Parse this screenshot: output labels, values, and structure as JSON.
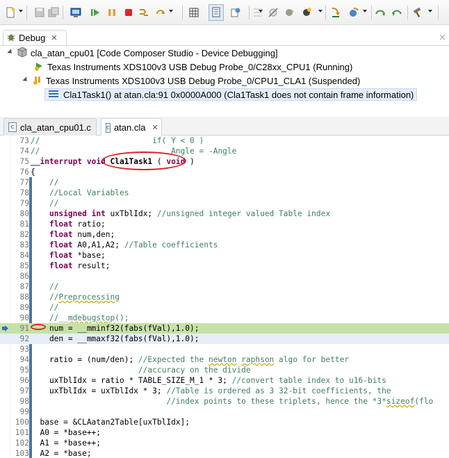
{
  "toolbar": {
    "icons": [
      "new-icon",
      "save-icon",
      "save-all-icon",
      "terminal-icon",
      "resume-icon",
      "suspend-icon",
      "terminate-icon",
      "reset-icon",
      "restart-icon",
      "memory-grid-icon",
      "debug-view-icon",
      "breakpoint-icon",
      "skip-breakpoints-icon",
      "hardware-breakpoint-icon",
      "step-into-icon",
      "step-over-icon",
      "step-return-icon",
      "step-back-icon",
      "build-icon"
    ]
  },
  "debug": {
    "tab_label": "Debug",
    "session": "cla_atan_cpu01 [Code Composer Studio - Device Debugging]",
    "targets": [
      {
        "label": "Texas Instruments XDS100v3 USB Debug Probe_0/C28xx_CPU1 (Running)"
      },
      {
        "label": "Texas Instruments XDS100v3 USB Debug Probe_0/CPU1_CLA1 (Suspended)"
      }
    ],
    "frame": "Cla1Task1() at atan.cla:91 0x0000A000  (Cla1Task1 does not contain frame information)"
  },
  "editor": {
    "tabs": [
      {
        "label": "cla_atan_cpu01.c",
        "active": false
      },
      {
        "label": "atan.cla",
        "active": true
      }
    ],
    "lines": [
      {
        "n": "73",
        "t": "//                        if( Y < 0 )"
      },
      {
        "n": "74",
        "t": "//                            Angle = -Angle"
      },
      {
        "n": "75",
        "t": "__interrupt void Cla1Task1 ( void )"
      },
      {
        "n": "76",
        "t": "{"
      },
      {
        "n": "77",
        "t": "    //"
      },
      {
        "n": "78",
        "t": "    //Local Variables"
      },
      {
        "n": "79",
        "t": "    //"
      },
      {
        "n": "80",
        "t": "    unsigned int uxTblIdx; //unsigned integer valued Table index"
      },
      {
        "n": "81",
        "t": "    float ratio;"
      },
      {
        "n": "82",
        "t": "    float num,den;"
      },
      {
        "n": "83",
        "t": "    float A0,A1,A2; //Table coefficients"
      },
      {
        "n": "84",
        "t": "    float *base;"
      },
      {
        "n": "85",
        "t": "    float result;"
      },
      {
        "n": "86",
        "t": ""
      },
      {
        "n": "87",
        "t": "    //"
      },
      {
        "n": "88",
        "t": "    //Preprocessing"
      },
      {
        "n": "89",
        "t": "    //"
      },
      {
        "n": "90",
        "t": "    //__mdebugstop();"
      },
      {
        "n": "91",
        "t": "    num = __mminf32(fabs(fVal),1.0);"
      },
      {
        "n": "92",
        "t": "    den = __mmaxf32(fabs(fVal),1.0);"
      },
      {
        "n": "93",
        "t": ""
      },
      {
        "n": "94",
        "t": "    ratio = (num/den); //Expected the newton raphson algo for better"
      },
      {
        "n": "95",
        "t": "                       //accuracy on the divide"
      },
      {
        "n": "96",
        "t": "    uxTblIdx = ratio * TABLE_SIZE_M_1 * 3; //convert table index to u16-bits"
      },
      {
        "n": "97",
        "t": "    uxTblIdx = uxTblIdx * 3; //Table is ordered as 3 32-bit coefficients, the"
      },
      {
        "n": "98",
        "t": "                             //index points to these triplets, hence the *3*sizeof(flo"
      },
      {
        "n": "99",
        "t": ""
      },
      {
        "n": "100",
        "t": "  base = &CLAatan2Table[uxTblIdx];"
      },
      {
        "n": "101",
        "t": "  A0 = *base++;"
      },
      {
        "n": "102",
        "t": "  A1 = *base++;"
      },
      {
        "n": "103",
        "t": "  A2 = *base;"
      }
    ]
  },
  "colors": {
    "keyword": "#7f0055",
    "comment": "#3f7f5f",
    "current_line": "#c6e1a8",
    "annotation": "#e0202a"
  }
}
